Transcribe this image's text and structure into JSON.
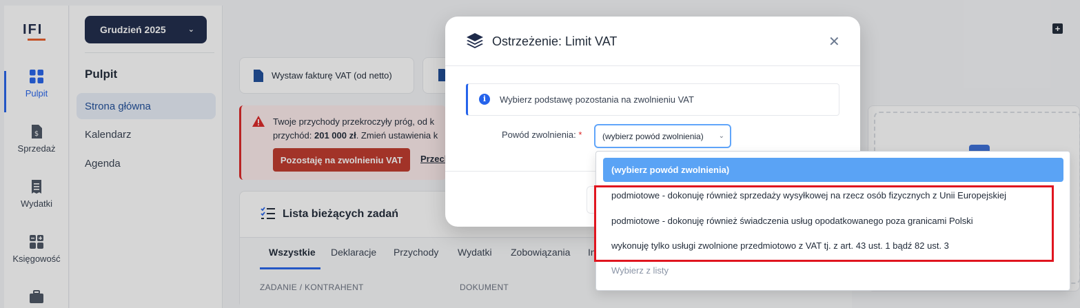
{
  "app": {
    "logo": "IFI",
    "rail": [
      {
        "label": "Pulpit",
        "icon": "dashboard-icon",
        "active": true
      },
      {
        "label": "Sprzedaż",
        "icon": "invoice-icon",
        "active": false
      },
      {
        "label": "Wydatki",
        "icon": "receipt-icon",
        "active": false
      },
      {
        "label": "Księgowość",
        "icon": "calculator-icon",
        "active": false
      },
      {
        "label": "",
        "icon": "briefcase-icon",
        "active": false
      }
    ],
    "month_button": "Grudzień 2025",
    "sidebar": {
      "title": "Pulpit",
      "items": [
        "Strona główna",
        "Kalendarz",
        "Agenda"
      ]
    },
    "actions": {
      "issue_invoice": "Wystaw fakturę VAT (od netto)"
    },
    "alert": {
      "line1": "Twoje przychody przekroczyły próg, od k",
      "line2_prefix": "przychód: ",
      "line2_amount": "201 000 zł",
      "line2_suffix": ". Zmień ustawienia k",
      "stay_button": "Pozostaję na zwolnieniu VAT",
      "link": "Przech"
    },
    "tasks": {
      "title": "Lista bieżących zadań",
      "tabs": [
        "Wszystkie",
        "Deklaracje",
        "Przychody",
        "Wydatki",
        "Zobowiązania",
        "In"
      ],
      "columns": [
        "ZADANIE / KONTRAHENT",
        "DOKUMENT"
      ]
    }
  },
  "modal": {
    "title": "Ostrzeżenie: Limit VAT",
    "info": "Wybierz podstawę pozostania na zwolnieniu VAT",
    "reason_label": "Powód zwolnienia:",
    "required_mark": "*",
    "select_value": "(wybierz powód zwolnienia)"
  },
  "dropdown": {
    "options": [
      "(wybierz powód zwolnienia)",
      "podmiotowe - dokonuję również sprzedaży wysyłkowej na rzecz osób fizycznych z Unii Europejskiej",
      "podmiotowe - dokonuję również świadczenia usług opodatkowanego poza granicami Polski",
      "wykonuję tylko usługi zwolnione przedmiotowo z VAT tj. z art. 43 ust. 1 bądź 82 ust. 3",
      "Wybierz z listy"
    ]
  },
  "colors": {
    "brand_navy": "#1e2a4a",
    "accent_blue": "#2563eb",
    "danger_red": "#c0392b",
    "selected_option": "#5aa3f5",
    "highlight_frame": "#e0151f"
  }
}
